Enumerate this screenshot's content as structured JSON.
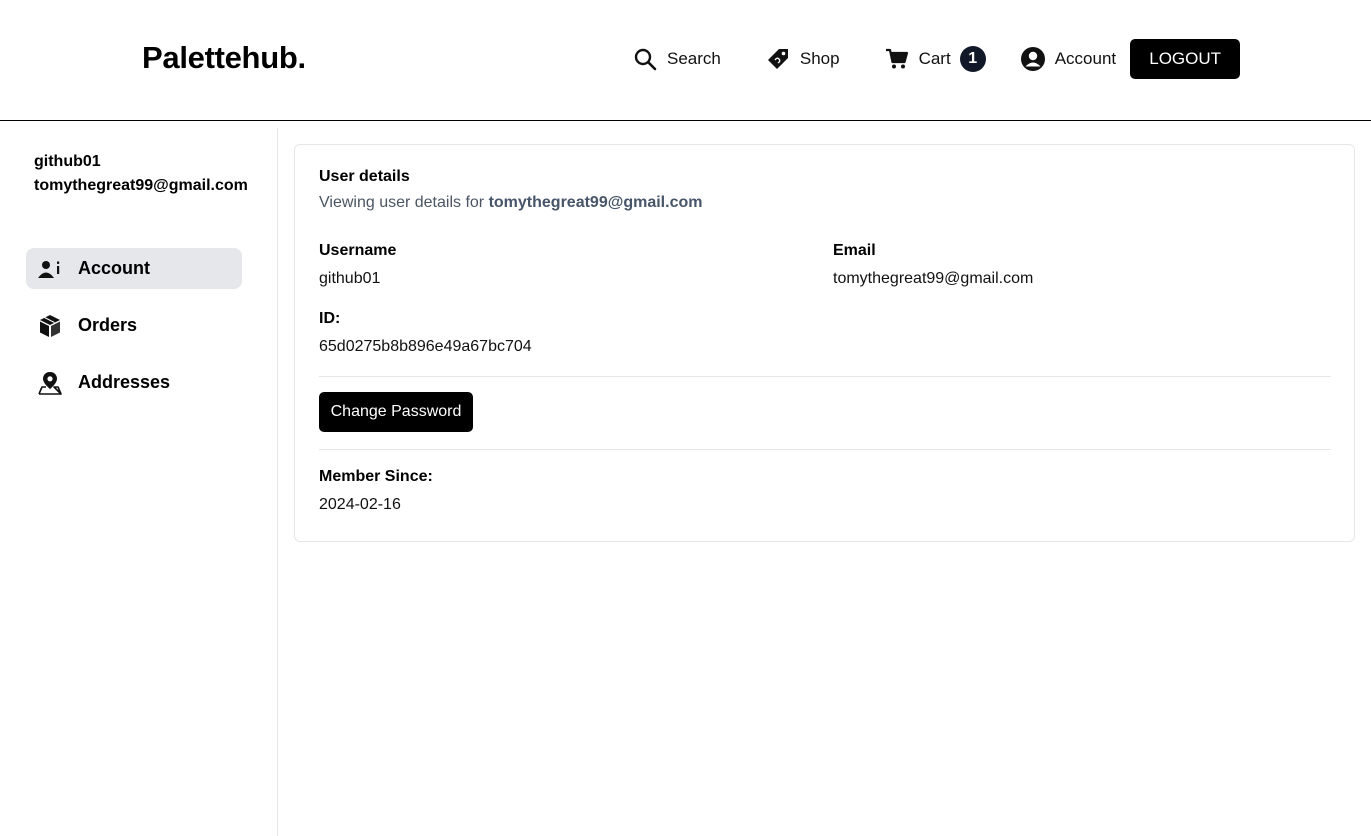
{
  "header": {
    "brand": "Palettehub.",
    "nav": {
      "search_label": "Search",
      "shop_label": "Shop",
      "cart_label": "Cart",
      "cart_count": "1",
      "account_label": "Account",
      "logout_label": "LOGOUT"
    }
  },
  "sidebar": {
    "username": "github01",
    "email": "tomythegreat99@gmail.com",
    "items": [
      {
        "label": "Account",
        "icon": "user-info-icon",
        "active": true
      },
      {
        "label": "Orders",
        "icon": "package-icon",
        "active": false
      },
      {
        "label": "Addresses",
        "icon": "map-pin-icon",
        "active": false
      }
    ]
  },
  "details": {
    "title": "User details",
    "subtitle_prefix": "Viewing user details for",
    "subtitle_email": "tomythegreat99@gmail.com",
    "username_label": "Username",
    "username_value": "github01",
    "email_label": "Email",
    "email_value": "tomythegreat99@gmail.com",
    "id_label": "ID:",
    "id_value": "65d0275b8b896e49a67bc704",
    "change_password_label": "Change Password",
    "member_since_label": "Member Since:",
    "member_since_value": "2024-02-16"
  },
  "colors": {
    "accent": "#000000",
    "badge_bg": "#111827",
    "active_item_bg": "#e5e7eb",
    "muted_text": "#4b5563",
    "border": "#e5e7eb"
  }
}
